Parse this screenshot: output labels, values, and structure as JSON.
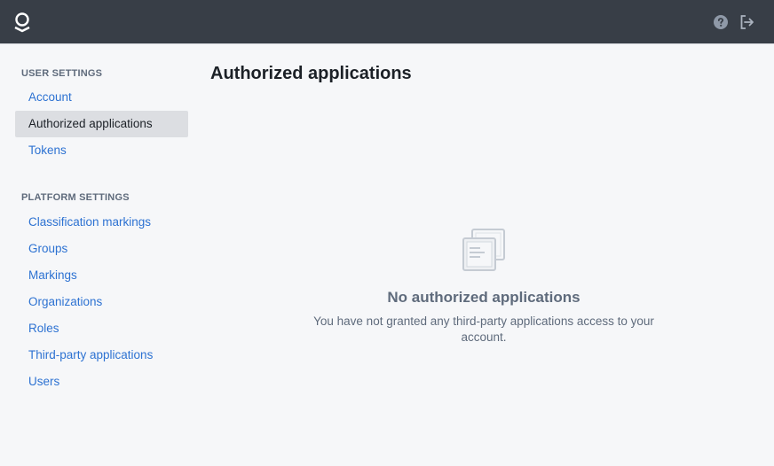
{
  "topbar": {
    "logo_icon": "palantir-logo-icon",
    "help_icon": "help-icon",
    "logout_icon": "log-out-icon"
  },
  "sidebar": {
    "sections": [
      {
        "label": "User settings",
        "items": [
          {
            "label": "Account",
            "active": false
          },
          {
            "label": "Authorized applications",
            "active": true
          },
          {
            "label": "Tokens",
            "active": false
          }
        ]
      },
      {
        "label": "Platform settings",
        "items": [
          {
            "label": "Classification markings",
            "active": false
          },
          {
            "label": "Groups",
            "active": false
          },
          {
            "label": "Markings",
            "active": false
          },
          {
            "label": "Organizations",
            "active": false
          },
          {
            "label": "Roles",
            "active": false
          },
          {
            "label": "Third-party applications",
            "active": false
          },
          {
            "label": "Users",
            "active": false
          }
        ]
      }
    ]
  },
  "main": {
    "title": "Authorized applications",
    "empty_state": {
      "icon": "applications-icon",
      "title": "No authorized applications",
      "description": "You have not granted any third-party applications access to your account."
    }
  },
  "colors": {
    "topbar": "#383e47",
    "link": "#2d72d2",
    "active_bg": "#dcdee2",
    "muted": "#5f6b7c"
  }
}
